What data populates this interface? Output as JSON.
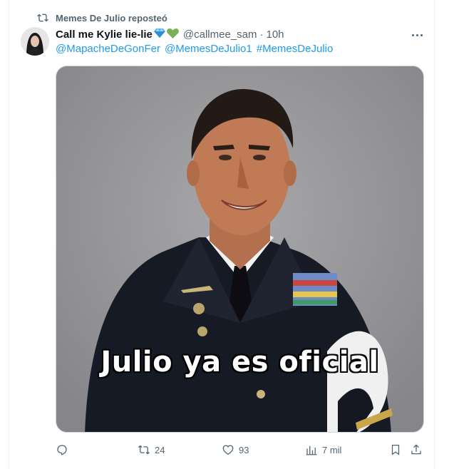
{
  "repost": {
    "text": "Memes De Julio reposteó",
    "icon": "repost-icon"
  },
  "tweet": {
    "author_name": "Call me Kylie lie-lie",
    "emojis": [
      "💎",
      "💚"
    ],
    "handle": "@callmee_sam",
    "separator": "·",
    "time": "10h",
    "mentions": [
      "@MapacheDeGonFer",
      "@MemesDeJulio1",
      "#MemesDeJulio"
    ],
    "image_caption": "Julio ya es oficial"
  },
  "actions": {
    "replies": "",
    "reposts": "24",
    "likes": "93",
    "views": "7 mil"
  },
  "colors": {
    "link": "#1d9bf0",
    "muted": "#536471",
    "border": "#cfd9de"
  }
}
